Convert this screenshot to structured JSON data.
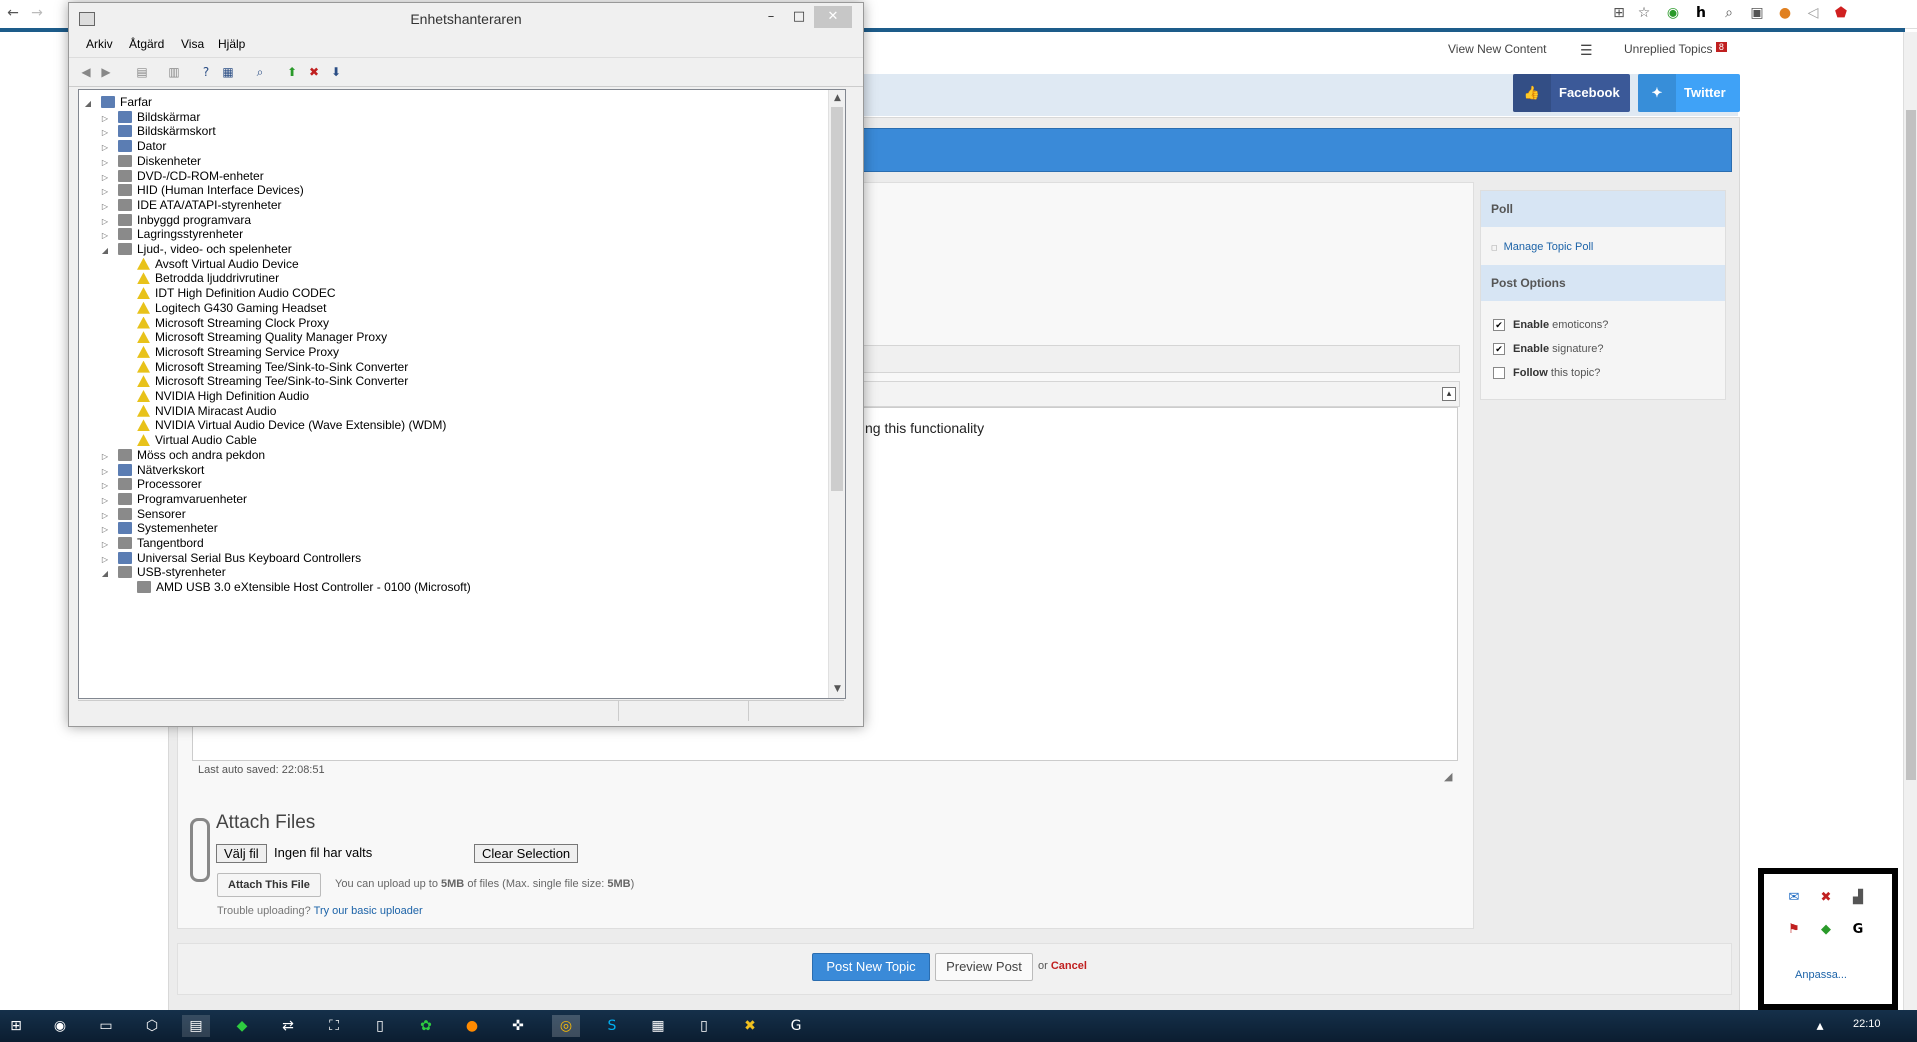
{
  "browser": {
    "icons": [
      "back-icon",
      "forward-icon",
      "translate-icon",
      "star-icon",
      "extension-o-icon",
      "h-icon",
      "search-icon",
      "gamepad-icon",
      "cookie-icon",
      "speaker-icon",
      "shield-icon"
    ]
  },
  "site": {
    "top_links": {
      "view_new": "View New Content",
      "unreplied": "Unreplied Topics",
      "unreplied_count": "8"
    },
    "social": {
      "facebook": "Facebook",
      "twitter": "Twitter"
    },
    "editor_text": "ng this functionality",
    "autosave": "Last auto saved: 22:08:51",
    "attach": {
      "title": "Attach Files",
      "choose_file": "Välj fil",
      "no_file": "Ingen fil har valts",
      "clear": "Clear Selection",
      "attach_btn": "Attach This File",
      "info_prefix": "You can upload up to ",
      "info_max": "5MB",
      "info_mid": " of files (Max. single file size: ",
      "info_single": "5MB",
      "info_suffix": ")",
      "trouble": "Trouble uploading? ",
      "basic": "Try our basic uploader"
    },
    "sidebar": {
      "poll_head": "Poll",
      "poll_link": "Manage Topic Poll",
      "options_head": "Post Options",
      "options": [
        {
          "bold": "Enable",
          "rest": " emoticons?",
          "checked": "✔"
        },
        {
          "bold": "Enable",
          "rest": " signature?",
          "checked": "✔"
        },
        {
          "bold": "Follow",
          "rest": " this topic?",
          "checked": ""
        }
      ]
    },
    "submit": {
      "post": "Post New Topic",
      "preview": "Preview Post",
      "or": "or ",
      "cancel": "Cancel"
    }
  },
  "device_manager": {
    "title": "Enhetshanteraren",
    "menu": [
      "Arkiv",
      "Åtgärd",
      "Visa",
      "Hjälp"
    ],
    "tree": [
      {
        "label": "Farfar",
        "level": 0,
        "exp": "◢",
        "icon": "computer"
      },
      {
        "label": "Bildskärmar",
        "level": 1,
        "exp": "▷",
        "icon": "device"
      },
      {
        "label": "Bildskärmskort",
        "level": 1,
        "exp": "▷",
        "icon": "device"
      },
      {
        "label": "Dator",
        "level": 1,
        "exp": "▷",
        "icon": "device"
      },
      {
        "label": "Diskenheter",
        "level": 1,
        "exp": "▷",
        "icon": "gray"
      },
      {
        "label": "DVD-/CD-ROM-enheter",
        "level": 1,
        "exp": "▷",
        "icon": "gray"
      },
      {
        "label": "HID (Human Interface Devices)",
        "level": 1,
        "exp": "▷",
        "icon": "gray"
      },
      {
        "label": "IDE ATA/ATAPI-styrenheter",
        "level": 1,
        "exp": "▷",
        "icon": "gray"
      },
      {
        "label": "Inbyggd programvara",
        "level": 1,
        "exp": "▷",
        "icon": "gray"
      },
      {
        "label": "Lagringsstyrenheter",
        "level": 1,
        "exp": "▷",
        "icon": "gray"
      },
      {
        "label": "Ljud-, video- och spelenheter",
        "level": 1,
        "exp": "◢",
        "icon": "gray"
      },
      {
        "label": "Avsoft Virtual Audio Device",
        "level": 2,
        "exp": "",
        "icon": "warn"
      },
      {
        "label": "Betrodda ljuddrivrutiner",
        "level": 2,
        "exp": "",
        "icon": "warn"
      },
      {
        "label": "IDT High Definition Audio CODEC",
        "level": 2,
        "exp": "",
        "icon": "warn"
      },
      {
        "label": "Logitech G430 Gaming Headset",
        "level": 2,
        "exp": "",
        "icon": "warn"
      },
      {
        "label": "Microsoft Streaming Clock Proxy",
        "level": 2,
        "exp": "",
        "icon": "warn"
      },
      {
        "label": "Microsoft Streaming Quality Manager Proxy",
        "level": 2,
        "exp": "",
        "icon": "warn"
      },
      {
        "label": "Microsoft Streaming Service Proxy",
        "level": 2,
        "exp": "",
        "icon": "warn"
      },
      {
        "label": "Microsoft Streaming Tee/Sink-to-Sink Converter",
        "level": 2,
        "exp": "",
        "icon": "warn"
      },
      {
        "label": "Microsoft Streaming Tee/Sink-to-Sink Converter",
        "level": 2,
        "exp": "",
        "icon": "warn"
      },
      {
        "label": "NVIDIA High Definition Audio",
        "level": 2,
        "exp": "",
        "icon": "warn"
      },
      {
        "label": "NVIDIA Miracast Audio",
        "level": 2,
        "exp": "",
        "icon": "warn"
      },
      {
        "label": "NVIDIA Virtual Audio Device (Wave Extensible) (WDM)",
        "level": 2,
        "exp": "",
        "icon": "warn"
      },
      {
        "label": "Virtual Audio Cable",
        "level": 2,
        "exp": "",
        "icon": "warn"
      },
      {
        "label": "Möss och andra pekdon",
        "level": 1,
        "exp": "▷",
        "icon": "gray"
      },
      {
        "label": "Nätverkskort",
        "level": 1,
        "exp": "▷",
        "icon": "device"
      },
      {
        "label": "Processorer",
        "level": 1,
        "exp": "▷",
        "icon": "gray"
      },
      {
        "label": "Programvaruenheter",
        "level": 1,
        "exp": "▷",
        "icon": "gray"
      },
      {
        "label": "Sensorer",
        "level": 1,
        "exp": "▷",
        "icon": "gray"
      },
      {
        "label": "Systemenheter",
        "level": 1,
        "exp": "▷",
        "icon": "device"
      },
      {
        "label": "Tangentbord",
        "level": 1,
        "exp": "▷",
        "icon": "gray"
      },
      {
        "label": "Universal Serial Bus Keyboard Controllers",
        "level": 1,
        "exp": "▷",
        "icon": "device"
      },
      {
        "label": "USB-styrenheter",
        "level": 1,
        "exp": "◢",
        "icon": "gray"
      },
      {
        "label": "AMD USB 3.0 eXtensible Host Controller - 0100 (Microsoft)",
        "level": 2,
        "exp": "",
        "icon": "gray"
      }
    ]
  },
  "tray": {
    "more": "Anpassa..."
  },
  "taskbar": {
    "clock": "22:10"
  }
}
